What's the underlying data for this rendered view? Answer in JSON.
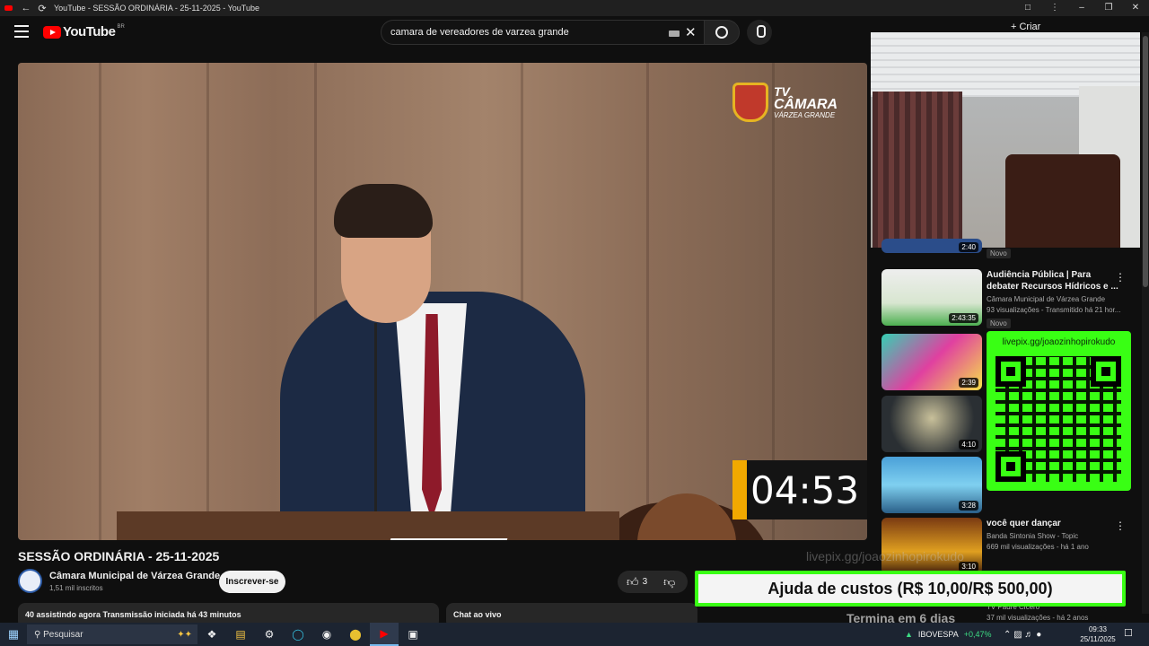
{
  "window": {
    "title": "YouTube - SESSÃO ORDINÁRIA - 25-11-2025 - YouTube"
  },
  "masthead": {
    "logo_text": "YouTube",
    "region": "BR",
    "search_query": "camara de vereadores de varzea grande",
    "create_label": "+ Criar"
  },
  "player": {
    "overlay_logo_line1": "TV",
    "overlay_logo_line2": "CÂMARA",
    "overlay_logo_line3": "VÁRZEA GRANDE",
    "timer": "04:53"
  },
  "video": {
    "title": "SESSÃO ORDINÁRIA - 25-11-2025",
    "channel_name": "Câmara Municipal de Várzea Grande",
    "subscribers": "1,51 mil inscritos",
    "subscribe_label": "Inscrever-se",
    "like_count": "3",
    "description_line": "40 assistindo agora  Transmissão iniciada há 43 minutos",
    "chat_label": "Chat ao vivo"
  },
  "recommendations": [
    {
      "duration": "2:40",
      "title": "",
      "channel": "",
      "views": "",
      "badge": "Novo"
    },
    {
      "duration": "2:43:35",
      "title": "Audiência Pública | Para debater Recursos Hídricos e ...",
      "channel": "Câmara Municipal de Várzea Grande",
      "views": "93 visualizações - Transmitido há 21 hor...",
      "badge": "Novo"
    },
    {
      "duration": "2:39"
    },
    {
      "duration": "4:10"
    },
    {
      "duration": "3:28"
    },
    {
      "duration": "3:10",
      "title": "você quer dançar",
      "channel": "Banda Sintonia Show - Topic",
      "views": "669 mil visualizações - há 1 ano"
    },
    {
      "title": "",
      "channel": "TV Padre Cicero",
      "views": "37 mil visualizações - há 2 anos"
    }
  ],
  "overlays": {
    "pix_url": "livepix.gg/joaozinhopirokudo",
    "pix_ghost": "livepix.gg/joaozinhopirokudo",
    "custos": "Ajuda de custos (R$ 10,00/R$ 500,00)",
    "termina": "Termina em 6 dias"
  },
  "taskbar": {
    "search_placeholder": "Pesquisar",
    "stock_name": "IBOVESPA",
    "stock_change": "+0,47%",
    "time": "09:33",
    "date": "25/11/2025"
  },
  "colors": {
    "youtube_red": "#ff0000",
    "pix_green": "#39ff14",
    "timer_accent": "#f2a900",
    "background": "#0f0f0f"
  }
}
